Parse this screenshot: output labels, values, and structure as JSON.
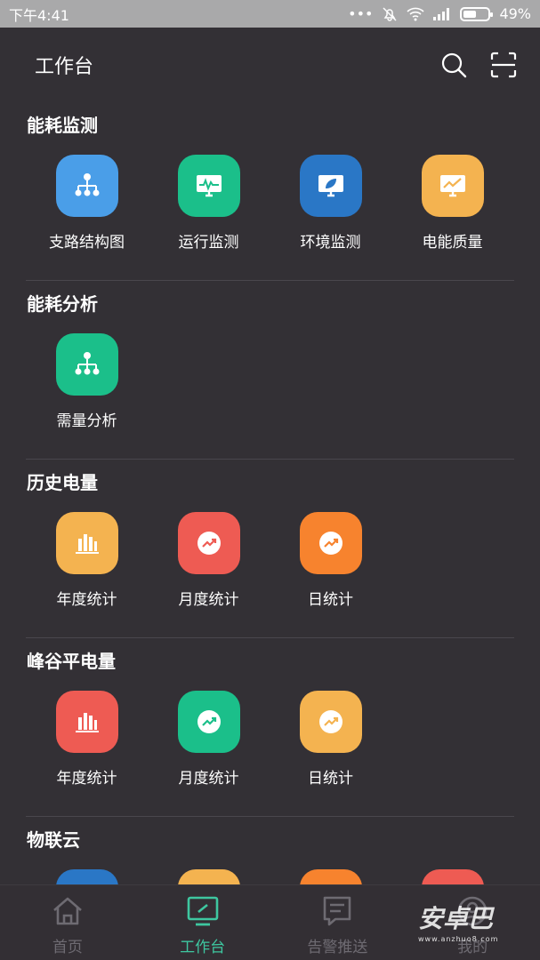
{
  "status_bar": {
    "time": "下午4:41",
    "battery": "49%"
  },
  "header": {
    "title": "工作台",
    "icons": [
      "search-icon",
      "scan-icon"
    ]
  },
  "sections": [
    {
      "title": "能耗监测",
      "items": [
        {
          "label": "支路结构图",
          "icon": "hierarchy-icon",
          "color": "#4a9ee8"
        },
        {
          "label": "运行监测",
          "icon": "monitor-pulse-icon",
          "color": "#1bbf8a"
        },
        {
          "label": "环境监测",
          "icon": "monitor-leaf-icon",
          "color": "#2a77c6"
        },
        {
          "label": "电能质量",
          "icon": "monitor-chart-icon",
          "color": "#f4b350"
        }
      ]
    },
    {
      "title": "能耗分析",
      "items": [
        {
          "label": "需量分析",
          "icon": "hierarchy-icon",
          "color": "#1bbf8a"
        }
      ]
    },
    {
      "title": "历史电量",
      "items": [
        {
          "label": "年度统计",
          "icon": "bar-chart-icon",
          "color": "#f4b350"
        },
        {
          "label": "月度统计",
          "icon": "trend-icon",
          "color": "#ee5b53"
        },
        {
          "label": "日统计",
          "icon": "trend-icon",
          "color": "#f7832e"
        }
      ]
    },
    {
      "title": "峰谷平电量",
      "items": [
        {
          "label": "年度统计",
          "icon": "bar-chart-icon",
          "color": "#ee5b53"
        },
        {
          "label": "月度统计",
          "icon": "trend-icon",
          "color": "#1bbf8a"
        },
        {
          "label": "日统计",
          "icon": "trend-icon",
          "color": "#f4b350"
        }
      ]
    },
    {
      "title": "物联云",
      "items": []
    }
  ],
  "tabs": [
    {
      "label": "首页",
      "icon": "home-icon",
      "active": false
    },
    {
      "label": "工作台",
      "icon": "workbench-icon",
      "active": true
    },
    {
      "label": "告警推送",
      "icon": "message-icon",
      "active": false
    },
    {
      "label": "我的",
      "icon": "user-icon",
      "active": false
    }
  ],
  "watermark": {
    "text": "安卓巴",
    "sub": "www.anzhuo8.com"
  }
}
